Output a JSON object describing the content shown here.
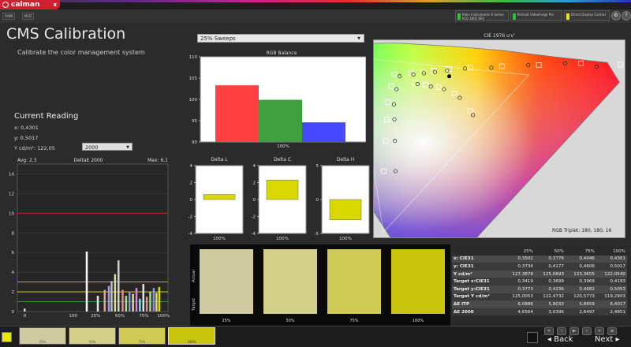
{
  "app": {
    "logo_text": "calman",
    "logo_close": "x",
    "tabs": [
      "FMIM",
      "MCD"
    ]
  },
  "devices": [
    {
      "label": "Klein Instruments K Series\nK10 1802 SEV",
      "color": "#30c040"
    },
    {
      "label": "Portrait VideoForge Pro",
      "color": "#30c040"
    },
    {
      "label": "Direct Display Control",
      "color": "#e8e800"
    }
  ],
  "header": {
    "title": "CMS Calibration",
    "subtitle": "Calibrate the color management system"
  },
  "sweep_select": {
    "value": "25% Sweeps"
  },
  "current_reading": {
    "title": "Current Reading",
    "x": "x: 0,4301",
    "y": "y: 0,5017",
    "Y": "Y cd/m²: 122,05",
    "de_select": "2000"
  },
  "cie": {
    "title": "CIE 1976 u'v'",
    "triplet": "RGB Triplet: 180, 180, 16"
  },
  "swatches": [
    {
      "label": "25%",
      "color": "#cfcaa0"
    },
    {
      "label": "50%",
      "color": "#d4d089"
    },
    {
      "label": "75%",
      "color": "#cfca54"
    },
    {
      "label": "100%",
      "color": "#c9c40c"
    }
  ],
  "swatch_side": {
    "top": "Actual",
    "bottom": "Target"
  },
  "table": {
    "headers": [
      "",
      "25%",
      "50%",
      "75%",
      "100%"
    ],
    "rows": [
      [
        "x: CIE31",
        "0,3502",
        "0,3776",
        "0,4046",
        "0,4301"
      ],
      [
        "y: CIE31",
        "0,3734",
        "0,4177",
        "0,4606",
        "0,5017"
      ],
      [
        "Y cd/m²",
        "127,3878",
        "125,0893",
        "123,3655",
        "122,0540"
      ],
      [
        "Target x:CIE31",
        "0,3419",
        "0,3699",
        "0,3969",
        "0,4193"
      ],
      [
        "Target y:CIE31",
        "0,3773",
        "0,4236",
        "0,4682",
        "0,5053"
      ],
      [
        "Target Y cd/m²",
        "125,0053",
        "122,4732",
        "120,5773",
        "119,2903"
      ],
      [
        "ΔE ITP",
        "6,0886",
        "5,8033",
        "5,8659",
        "6,4017"
      ],
      [
        "ΔE 2000",
        "4,6564",
        "3,0396",
        "2,6497",
        "2,4851"
      ]
    ]
  },
  "bottom": {
    "chips": [
      {
        "label": "25%",
        "color": "#cfcaa0"
      },
      {
        "label": "50%",
        "color": "#d4d089"
      },
      {
        "label": "75%",
        "color": "#cfca54"
      },
      {
        "label": "100%",
        "color": "#c9c40c"
      }
    ],
    "back_label": "Back",
    "next_label": "Next"
  },
  "chart_data": [
    {
      "type": "bar",
      "title": "RGB Balance",
      "categories": [
        "100%"
      ],
      "series": [
        {
          "values": [
            103.3
          ],
          "color": "#ff4040"
        },
        {
          "values": [
            99.9
          ],
          "color": "#40a040"
        },
        {
          "values": [
            94.6
          ],
          "color": "#4848ff"
        }
      ],
      "ylim": [
        90,
        110
      ],
      "yticks": [
        "90",
        "95",
        "100",
        "105",
        "110"
      ],
      "xlabel": "100%"
    },
    {
      "type": "bar",
      "title": "Delta L",
      "categories": [
        "100%"
      ],
      "values": [
        0.6
      ],
      "ylim": [
        -4,
        4
      ],
      "yticks": [
        "-4",
        "-2",
        "0",
        "2",
        "4"
      ],
      "xlabel": "100%",
      "color": "#d8d800"
    },
    {
      "type": "bar",
      "title": "Delta C",
      "categories": [
        "100%"
      ],
      "values": [
        2.3
      ],
      "ylim": [
        -4,
        4
      ],
      "yticks": [
        "-4",
        "-2",
        "0",
        "2",
        "4"
      ],
      "xlabel": "100%",
      "color": "#d8d800"
    },
    {
      "type": "bar",
      "title": "Delta H",
      "categories": [
        "100%"
      ],
      "values": [
        -3.0
      ],
      "ylim": [
        -5,
        5
      ],
      "yticks": [
        "-5",
        "0",
        "5"
      ],
      "xlabel": "100%",
      "color": "#d8d800"
    },
    {
      "type": "bar",
      "title": "DeltaE 2000",
      "avg_label": "Avg: 2,3",
      "max_label": "Max: 6,1",
      "ylim": [
        0,
        15
      ],
      "yticks": [
        "0",
        "2",
        "4",
        "6",
        "8",
        "10",
        "12",
        "14"
      ],
      "xticks": [
        "0",
        "100",
        "25%",
        "50%",
        "75%",
        "100%"
      ],
      "threshold_lines": [
        {
          "value": 10,
          "color": "#e02020"
        },
        {
          "value": 3,
          "color": "#e8e800"
        },
        {
          "value": 2,
          "color": "#e8e800"
        },
        {
          "value": 1,
          "color": "#30c030"
        }
      ],
      "bars": [
        {
          "x": 0.0,
          "value": 0.3,
          "color": "#d8d8d8"
        },
        {
          "x": 0.45,
          "value": 6.1,
          "color": "#ffffff"
        },
        {
          "x": 0.53,
          "value": 1.6,
          "color": "#e8e8e8"
        },
        {
          "x": 0.58,
          "value": 2.2,
          "color": "#e0a0a0"
        },
        {
          "x": 0.61,
          "value": 2.6,
          "color": "#a0a0e0"
        },
        {
          "x": 0.63,
          "value": 3.1,
          "color": "#c0c0c0"
        },
        {
          "x": 0.655,
          "value": 3.8,
          "color": "#e0e0a0"
        },
        {
          "x": 0.68,
          "value": 5.2,
          "color": "#d0d0d0"
        },
        {
          "x": 0.71,
          "value": 2.2,
          "color": "#e09090"
        },
        {
          "x": 0.735,
          "value": 1.6,
          "color": "#a0e0a0"
        },
        {
          "x": 0.76,
          "value": 2.0,
          "color": "#9090e0"
        },
        {
          "x": 0.785,
          "value": 1.8,
          "color": "#e0e0a0"
        },
        {
          "x": 0.81,
          "value": 2.4,
          "color": "#e080e0"
        },
        {
          "x": 0.835,
          "value": 1.3,
          "color": "#80e0e0"
        },
        {
          "x": 0.86,
          "value": 2.8,
          "color": "#e0e0e0"
        },
        {
          "x": 0.885,
          "value": 1.5,
          "color": "#e09090"
        },
        {
          "x": 0.91,
          "value": 2.0,
          "color": "#90e090"
        },
        {
          "x": 0.935,
          "value": 2.4,
          "color": "#9090e0"
        },
        {
          "x": 0.955,
          "value": 1.9,
          "color": "#e0e060"
        },
        {
          "x": 0.975,
          "value": 2.5,
          "color": "#e0e000"
        }
      ]
    },
    {
      "type": "scatter",
      "title": "CIE 1976 u'v'",
      "measured": [
        [
          0.206,
          0.52
        ],
        [
          0.232,
          0.524
        ],
        [
          0.252,
          0.527
        ],
        [
          0.273,
          0.53
        ],
        [
          0.296,
          0.533
        ],
        [
          0.33,
          0.538
        ],
        [
          0.38,
          0.54
        ],
        [
          0.45,
          0.546
        ],
        [
          0.52,
          0.55
        ],
        [
          0.58,
          0.542
        ],
        [
          0.2,
          0.49
        ],
        [
          0.195,
          0.455
        ],
        [
          0.196,
          0.42
        ],
        [
          0.197,
          0.37
        ],
        [
          0.198,
          0.3
        ],
        [
          0.24,
          0.502
        ],
        [
          0.265,
          0.496
        ],
        [
          0.29,
          0.49
        ],
        [
          0.32,
          0.47
        ],
        [
          0.345,
          0.43
        ]
      ],
      "targets": [
        [
          0.196,
          0.524
        ],
        [
          0.228,
          0.528
        ],
        [
          0.25,
          0.53
        ],
        [
          0.27,
          0.533
        ],
        [
          0.3,
          0.537
        ],
        [
          0.34,
          0.54
        ],
        [
          0.4,
          0.543
        ],
        [
          0.47,
          0.546
        ],
        [
          0.55,
          0.55
        ],
        [
          0.625,
          0.547
        ],
        [
          0.19,
          0.497
        ],
        [
          0.183,
          0.46
        ],
        [
          0.182,
          0.42
        ],
        [
          0.18,
          0.37
        ],
        [
          0.176,
          0.3
        ],
        [
          0.235,
          0.505
        ],
        [
          0.255,
          0.5
        ],
        [
          0.28,
          0.495
        ],
        [
          0.31,
          0.48
        ],
        [
          0.34,
          0.44
        ]
      ],
      "current": [
        0.3,
        0.52
      ]
    }
  ]
}
